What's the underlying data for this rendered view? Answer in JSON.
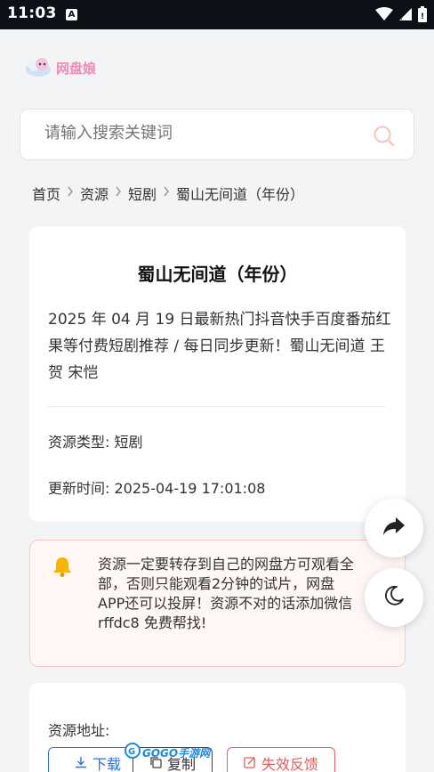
{
  "status_bar": {
    "time": "11:03",
    "notif_badge": "A"
  },
  "header": {
    "logo_text": "网盘娘"
  },
  "search": {
    "placeholder": "请输入搜索关键词"
  },
  "breadcrumb": {
    "items": [
      "首页",
      "资源",
      "短剧",
      "蜀山无间道（年份）"
    ]
  },
  "detail": {
    "title": "蜀山无间道（年份）",
    "description": "2025 年 04 月 19 日最新热门抖音快手百度番茄红果等付费短剧推荐 / 每日同步更新！蜀山无间道 王贺 宋恺",
    "type_label": "资源类型:",
    "type_value": "短剧",
    "time_label": "更新时间:",
    "time_value": "2025-04-19 17:01:08"
  },
  "notice": {
    "text": "资源一定要转存到自己的网盘方可观看全部，否则只能观看2分钟的试片，网盘APP还可以投屏！资源不对的话添加微信 rffdc8 免费帮找!"
  },
  "resource": {
    "label": "资源地址:",
    "download_label": "下载",
    "copy_label": "复制",
    "report_label": "失效反馈"
  },
  "watermark": {
    "text": "GOGO手游网"
  },
  "colors": {
    "accent": "#2f6fe6",
    "danger": "#e85a5a",
    "logo": "#f08ab8",
    "notice_bg": "#fff6f6"
  },
  "icons": [
    "wifi-icon",
    "signal-icon",
    "battery-icon",
    "search-icon",
    "chevron-right-icon",
    "bell-icon",
    "share-icon",
    "moon-icon",
    "download-icon",
    "copy-icon",
    "report-icon"
  ]
}
